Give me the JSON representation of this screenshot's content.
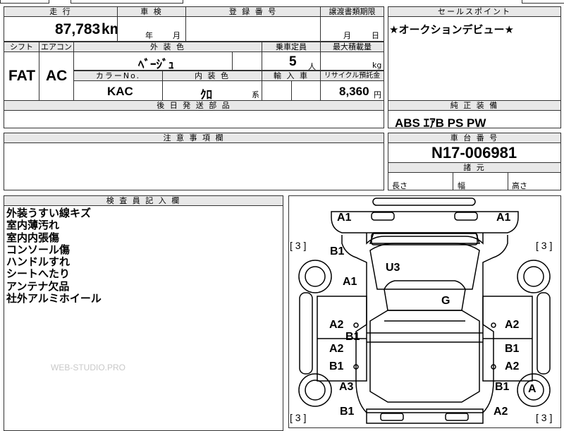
{
  "sheet": {
    "top_partial": "",
    "mileage_header": "走 行",
    "mileage_value": "87,783",
    "mileage_unit": "km",
    "shaken_header": "車 検",
    "shaken_year_label": "年",
    "shaken_month_label": "月",
    "registration_header": "登 録 番 号",
    "transfer_deadline_header": "譲渡書類期限",
    "transfer_month_label": "月",
    "transfer_day_label": "日",
    "sales_point_header": "セールスポイント",
    "sales_point_text": "★オークションデビュー★",
    "shift_header": "シフト",
    "shift_value": "FAT",
    "aircon_header": "エアコン",
    "aircon_value": "AC",
    "exterior_color_header": "外 装 色",
    "exterior_color_value": "ﾍﾞｰｼﾞｭ",
    "capacity_header": "乗車定員",
    "capacity_value": "5",
    "capacity_unit": "人",
    "max_load_header": "最大積載量",
    "max_load_unit": "kg",
    "color_no_header": "カラーNo.",
    "color_no_value": "KAC",
    "interior_color_header": "内 装 色",
    "interior_color_value": "ｸﾛ",
    "interior_color_suffix": "系",
    "import_header": "輸 入 車",
    "recycle_header": "リサイクル預託金",
    "recycle_value": "8,360",
    "recycle_unit": "円",
    "later_parts_header": "後 日 発 送 部 品",
    "standard_equipment_header": "純 正 装 備",
    "standard_equipment_value": "ABS ｴｱB PS PW",
    "caution_header": "注 意 事 項 欄",
    "chassis_number_header": "車 台 番 号",
    "chassis_number_value": "N17-006981",
    "dimensions_header": "諸 元",
    "length_label": "長さ",
    "width_label": "幅",
    "height_label": "高さ",
    "inspector_header": "検 査 員 記 入 欄",
    "inspector_notes": [
      "外装うすい線キズ",
      "室内薄汚れ",
      "室内内張傷",
      "コンソール傷",
      "ハンドルすれ",
      "シートへたり",
      "アンテナ欠品",
      "社外アルミホイール"
    ],
    "watermark": "WEB-STUDIO.PRO"
  },
  "diagram": {
    "brackets": {
      "top_left": "[ 3 ]",
      "top_right": "[ 3 ]",
      "bottom_left": "[ 3 ]",
      "bottom_right": "[ 3 ]"
    },
    "marks": {
      "front_bumper_left": "A1",
      "front_bumper_right": "A1",
      "left_front_fender": "B1",
      "left_front_door_area": "A1",
      "hood": "U3",
      "roof": "G",
      "left_front_door": "A2",
      "left_front_door_b": "B1",
      "left_rear_door": "A2",
      "left_rocker": "B1",
      "left_rear_fender": "A3",
      "rear_bumper_left": "B1",
      "right_front_door": "A2",
      "right_front_door_b": "B1",
      "right_rear_door": "A2",
      "right_rear_fender": "B1",
      "rear_bumper_right": "A2",
      "right_rear_wheel": "A"
    }
  }
}
